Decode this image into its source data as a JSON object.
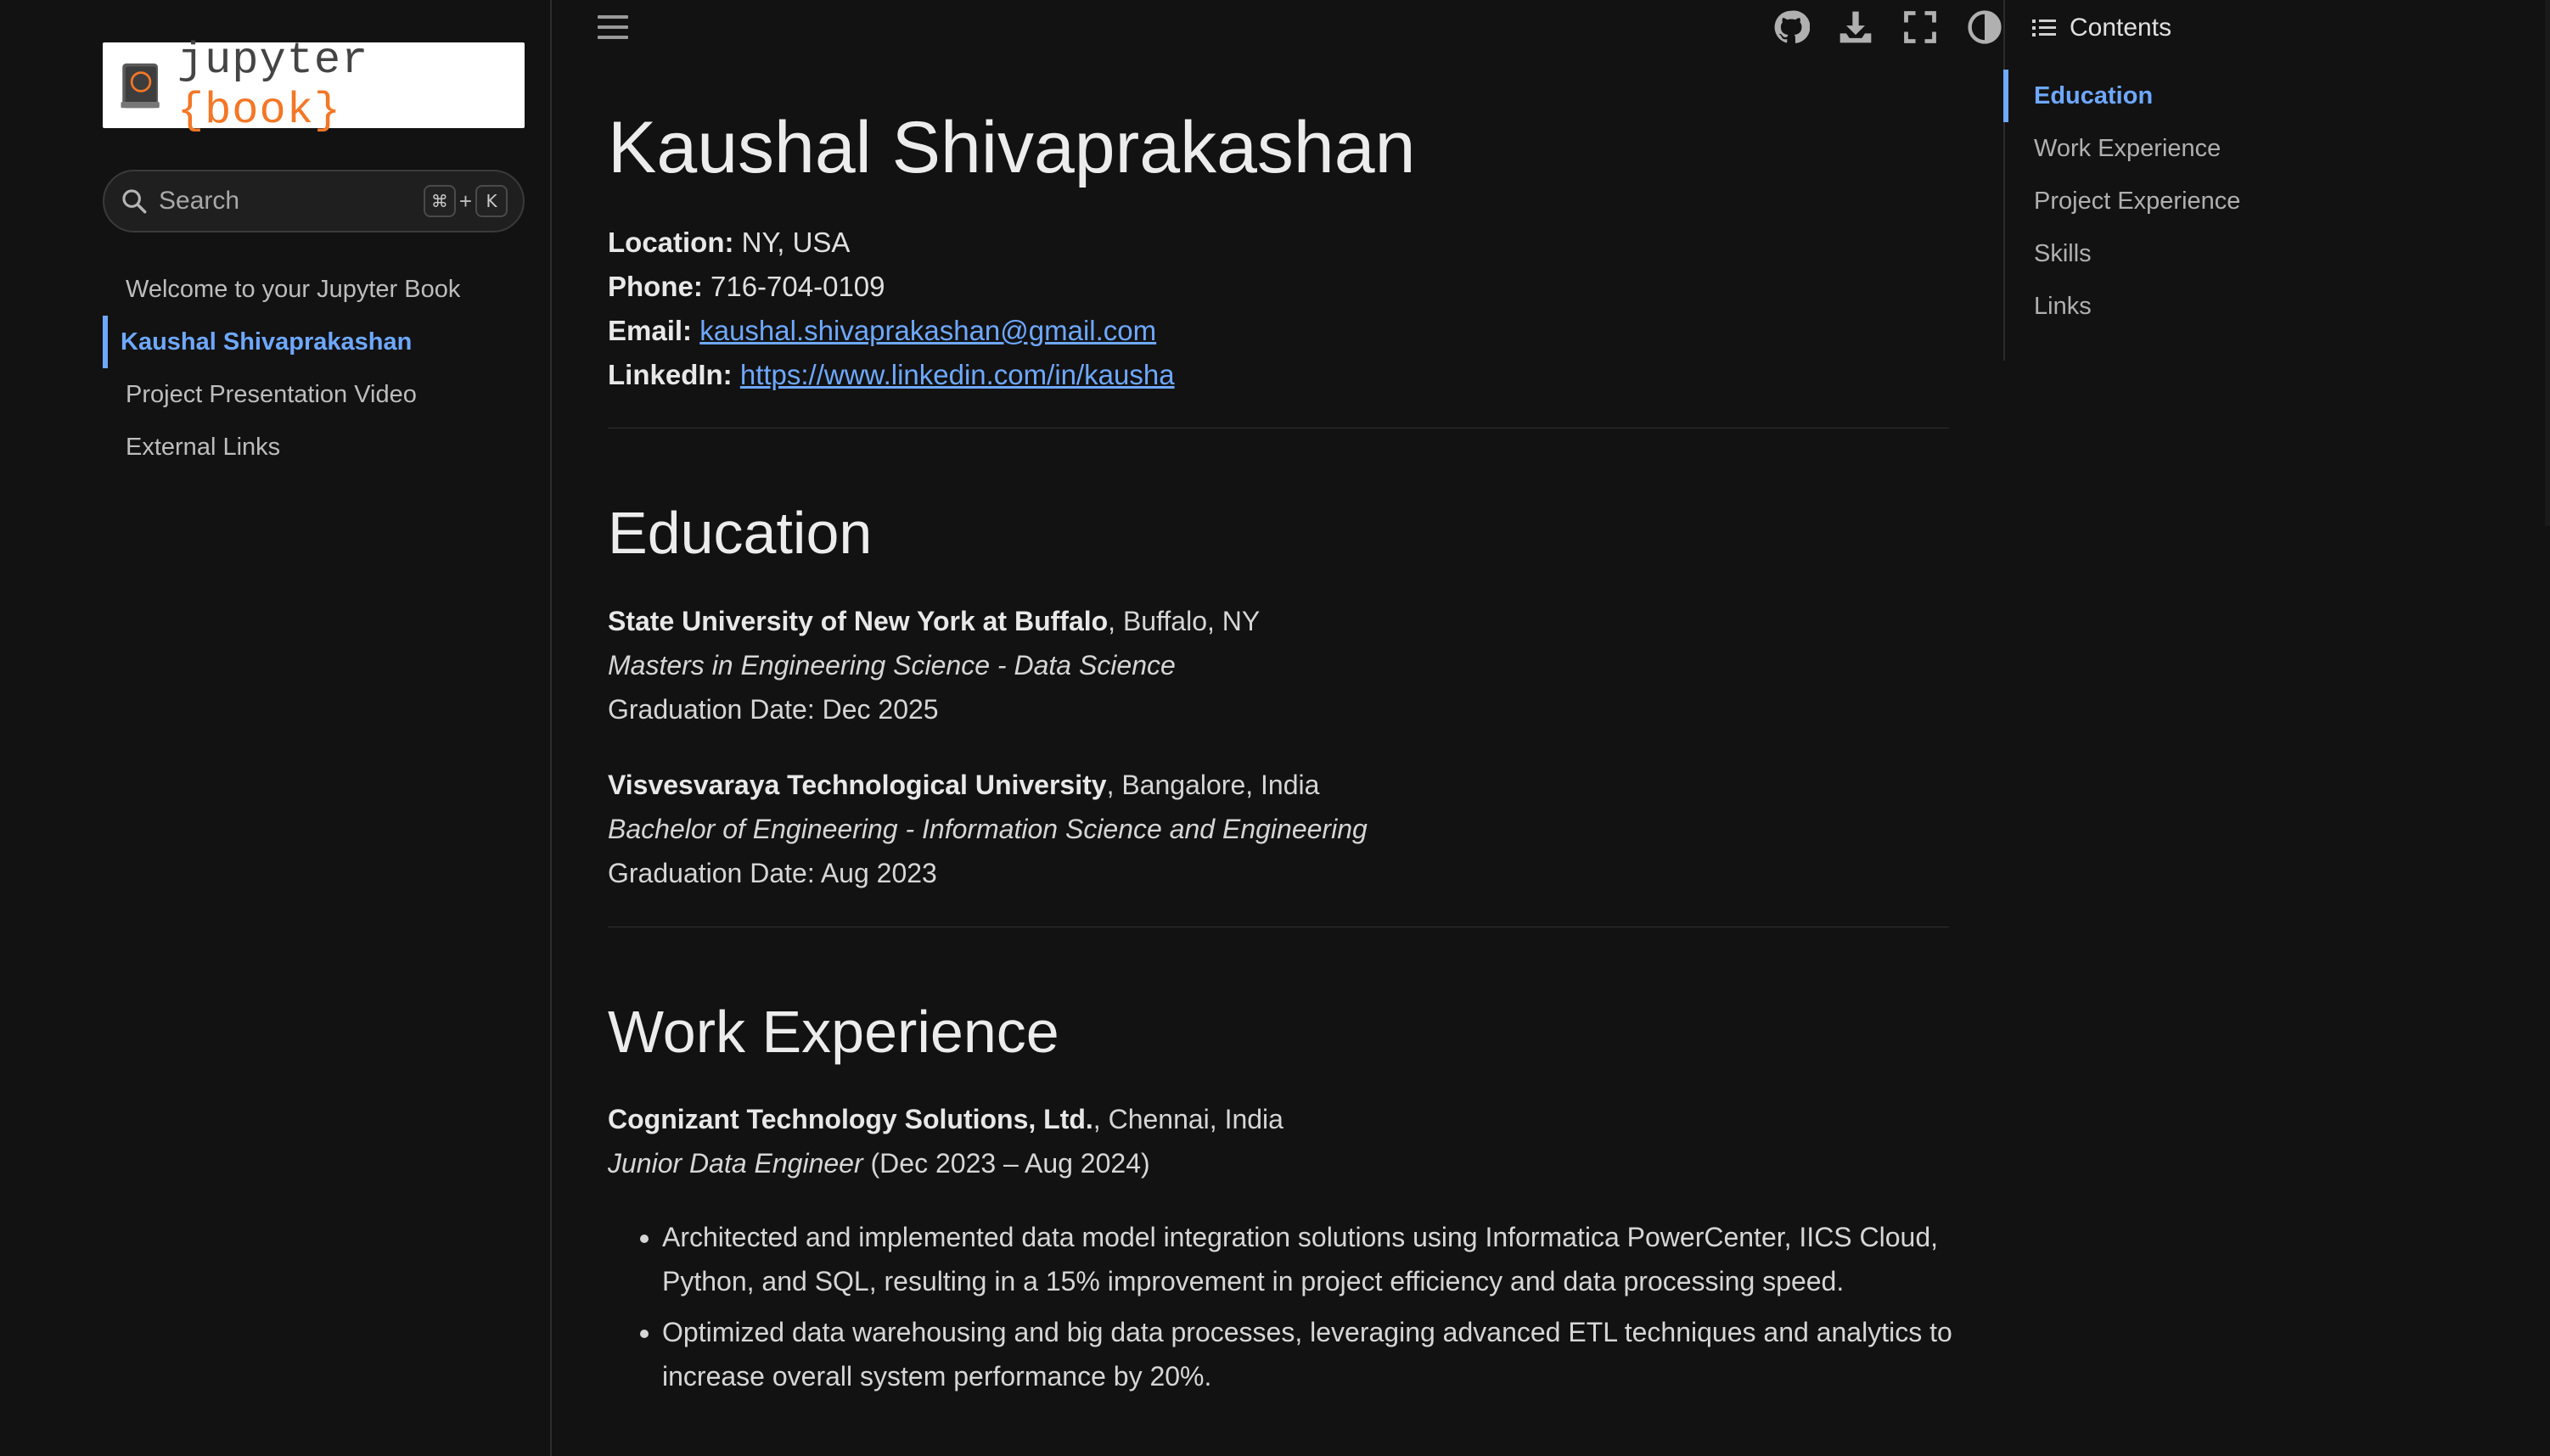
{
  "sidebar": {
    "logo_text": "jupyter",
    "logo_brace_open": "{",
    "logo_book": "book",
    "logo_brace_close": "}",
    "search": {
      "placeholder": "Search",
      "shortcut_mod": "⌘",
      "shortcut_plus": "+",
      "shortcut_key": "K"
    },
    "items": [
      {
        "label": "Welcome to your Jupyter Book",
        "active": false
      },
      {
        "label": "Kaushal Shivaprakashan",
        "active": true
      },
      {
        "label": "Project Presentation Video",
        "active": false
      },
      {
        "label": "External Links",
        "active": false
      }
    ]
  },
  "header": {
    "icons": [
      "menu-icon",
      "github-icon",
      "download-icon",
      "fullscreen-icon",
      "theme-toggle-icon"
    ]
  },
  "main": {
    "title": "Kaushal Shivaprakashan",
    "contact": {
      "location_label": "Location:",
      "location": "NY, USA",
      "phone_label": "Phone:",
      "phone": "716-704-0109",
      "email_label": "Email:",
      "email": "kaushal.shivaprakashan@gmail.com",
      "linkedin_label": "LinkedIn:",
      "linkedin": "https://www.linkedin.com/in/kausha"
    },
    "education": {
      "heading": "Education",
      "entries": [
        {
          "school": "State University of New York at Buffalo",
          "location": ", Buffalo, NY",
          "degree": "Masters in Engineering Science - Data Science",
          "graduation": "Graduation Date: Dec 2025"
        },
        {
          "school": "Visvesvaraya Technological University",
          "location": ", Bangalore, India",
          "degree": "Bachelor of Engineering - Information Science and Engineering",
          "graduation": "Graduation Date: Aug 2023"
        }
      ]
    },
    "work": {
      "heading": "Work Experience",
      "company": "Cognizant Technology Solutions, Ltd.",
      "location": ", Chennai, India",
      "role": "Junior Data Engineer",
      "dates": " (Dec 2023 – Aug 2024)",
      "bullets": [
        "Architected and implemented data model integration solutions using Informatica PowerCenter, IICS Cloud, Python, and SQL, resulting in a 15% improvement in project efficiency and data processing speed.",
        "Optimized data warehousing and big data processes, leveraging advanced ETL techniques and analytics to increase overall system performance by 20%."
      ]
    }
  },
  "toc": {
    "heading": "Contents",
    "items": [
      {
        "label": "Education",
        "active": true
      },
      {
        "label": "Work Experience",
        "active": false
      },
      {
        "label": "Project Experience",
        "active": false
      },
      {
        "label": "Skills",
        "active": false
      },
      {
        "label": "Links",
        "active": false
      }
    ]
  },
  "colors": {
    "accent": "#6ea8ff",
    "brand": "#f37726",
    "background": "#121212"
  }
}
